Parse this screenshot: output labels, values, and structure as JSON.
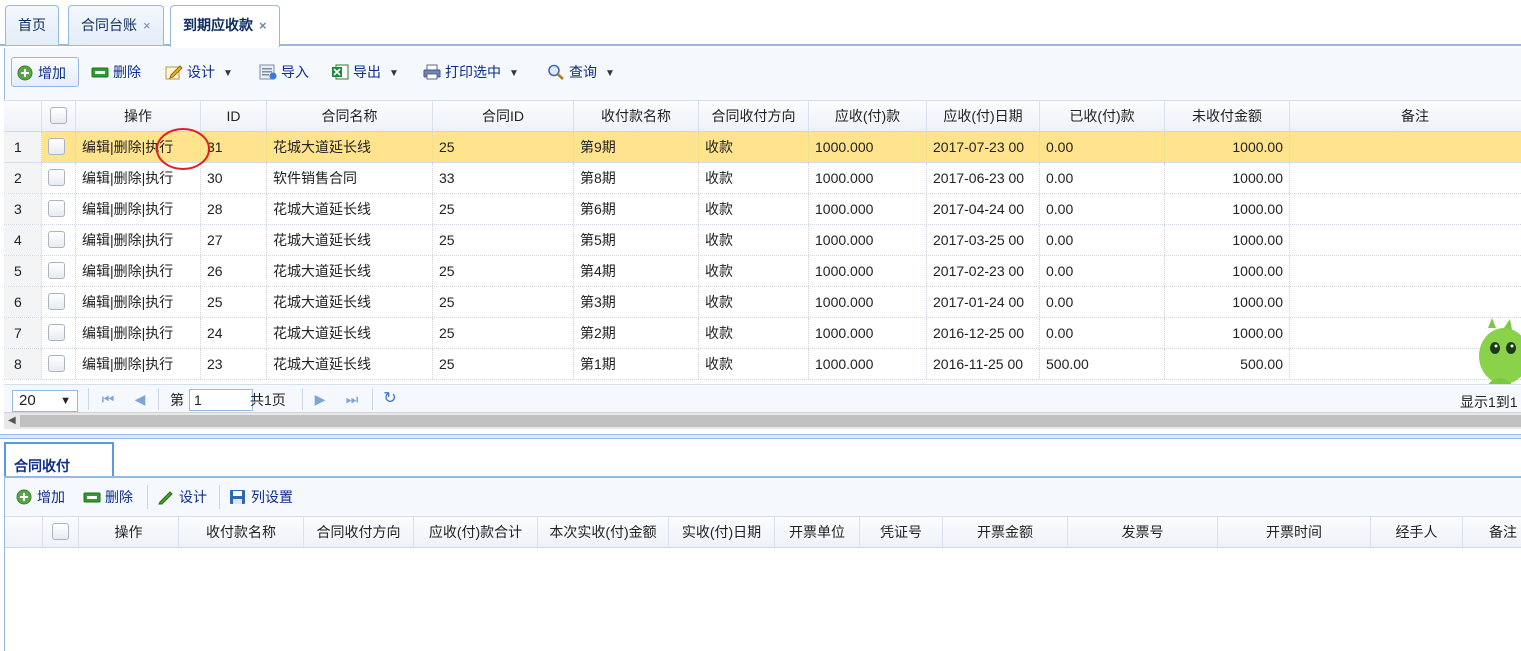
{
  "tabs": [
    {
      "label": "首页",
      "closable": false,
      "active": false
    },
    {
      "label": "合同台账",
      "closable": true,
      "active": false
    },
    {
      "label": "到期应收款",
      "closable": true,
      "active": true
    }
  ],
  "close_glyph": "×",
  "toolbar": {
    "add": "增加",
    "delete": "删除",
    "design": "设计",
    "import": "导入",
    "export": "导出",
    "print_selected": "打印选中",
    "query": "查询"
  },
  "grid": {
    "columns": [
      "操作",
      "ID",
      "合同名称",
      "合同ID",
      "收付款名称",
      "合同收付方向",
      "应收(付)款",
      "应收(付)日期",
      "已收(付)款",
      "未收付金额",
      "备注"
    ],
    "op_labels": {
      "edit": "编辑",
      "delete": "删除",
      "execute": "执行",
      "sep": "|"
    },
    "rows": [
      {
        "num": "1",
        "id": "31",
        "contract_name": "花城大道延长线",
        "contract_id": "25",
        "payment_name": "第9期",
        "direction": "收款",
        "due_amount": "1000.000",
        "due_date": "2017-07-23 00",
        "paid": "0.00",
        "unpaid": "1000.00",
        "remark": "",
        "selected": true
      },
      {
        "num": "2",
        "id": "30",
        "contract_name": "软件销售合同",
        "contract_id": "33",
        "payment_name": "第8期",
        "direction": "收款",
        "due_amount": "1000.000",
        "due_date": "2017-06-23 00",
        "paid": "0.00",
        "unpaid": "1000.00",
        "remark": ""
      },
      {
        "num": "3",
        "id": "28",
        "contract_name": "花城大道延长线",
        "contract_id": "25",
        "payment_name": "第6期",
        "direction": "收款",
        "due_amount": "1000.000",
        "due_date": "2017-04-24 00",
        "paid": "0.00",
        "unpaid": "1000.00",
        "remark": ""
      },
      {
        "num": "4",
        "id": "27",
        "contract_name": "花城大道延长线",
        "contract_id": "25",
        "payment_name": "第5期",
        "direction": "收款",
        "due_amount": "1000.000",
        "due_date": "2017-03-25 00",
        "paid": "0.00",
        "unpaid": "1000.00",
        "remark": ""
      },
      {
        "num": "5",
        "id": "26",
        "contract_name": "花城大道延长线",
        "contract_id": "25",
        "payment_name": "第4期",
        "direction": "收款",
        "due_amount": "1000.000",
        "due_date": "2017-02-23 00",
        "paid": "0.00",
        "unpaid": "1000.00",
        "remark": ""
      },
      {
        "num": "6",
        "id": "25",
        "contract_name": "花城大道延长线",
        "contract_id": "25",
        "payment_name": "第3期",
        "direction": "收款",
        "due_amount": "1000.000",
        "due_date": "2017-01-24 00",
        "paid": "0.00",
        "unpaid": "1000.00",
        "remark": ""
      },
      {
        "num": "7",
        "id": "24",
        "contract_name": "花城大道延长线",
        "contract_id": "25",
        "payment_name": "第2期",
        "direction": "收款",
        "due_amount": "1000.000",
        "due_date": "2016-12-25 00",
        "paid": "0.00",
        "unpaid": "1000.00",
        "remark": ""
      },
      {
        "num": "8",
        "id": "23",
        "contract_name": "花城大道延长线",
        "contract_id": "25",
        "payment_name": "第1期",
        "direction": "收款",
        "due_amount": "1000.000",
        "due_date": "2016-11-25 00",
        "paid": "500.00",
        "unpaid": "500.00",
        "remark": ""
      }
    ]
  },
  "pager": {
    "page_size": "20",
    "page_prefix": "第",
    "page_value": "1",
    "page_total": "共1页",
    "showing": "显示1到1"
  },
  "subpanel": {
    "tab_label": "合同收付",
    "toolbar": {
      "add": "增加",
      "delete": "删除",
      "design": "设计",
      "columns": "列设置"
    },
    "columns": [
      "操作",
      "收付款名称",
      "合同收付方向",
      "应收(付)款合计",
      "本次实收(付)金额",
      "实收(付)日期",
      "开票单位",
      "凭证号",
      "开票金额",
      "发票号",
      "开票时间",
      "经手人",
      "备注"
    ]
  },
  "colors": {
    "border": "#95b8e7",
    "selected_row": "#ffe48d",
    "link": "#0e2d8c",
    "annotation_circle": "#e02020"
  }
}
